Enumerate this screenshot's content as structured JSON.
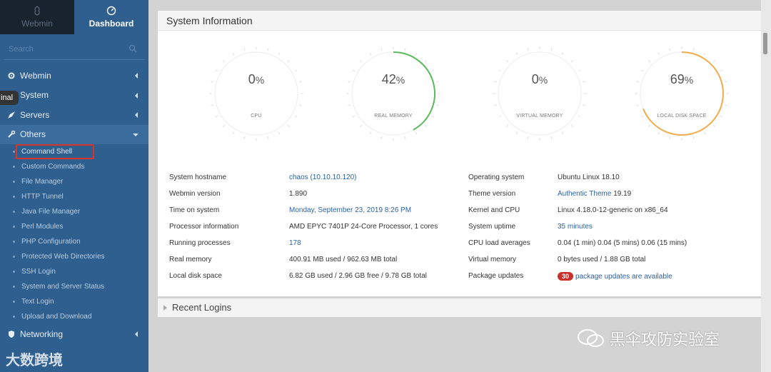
{
  "sidebar": {
    "tabs": [
      {
        "label": "Webmin",
        "icon": "webmin-logo-icon",
        "active": false
      },
      {
        "label": "Dashboard",
        "icon": "dashboard-gauge-icon",
        "active": true
      }
    ],
    "search_placeholder": "Search",
    "items": [
      {
        "label": "Webmin",
        "icon": "gear-icon"
      },
      {
        "label": "System",
        "icon": "wrench-icon"
      },
      {
        "label": "Servers",
        "icon": "rocket-icon"
      },
      {
        "label": "Others",
        "icon": "wrench-icon",
        "open": true
      },
      {
        "label": "Networking",
        "icon": "shield-icon"
      }
    ],
    "others_sub": [
      "Command Shell",
      "Custom Commands",
      "File Manager",
      "HTTP Tunnel",
      "Java File Manager",
      "Perl Modules",
      "PHP Configuration",
      "Protected Web Directories",
      "SSH Login",
      "System and Server Status",
      "Text Login",
      "Upload and Download"
    ],
    "tooltip": "inal",
    "watermark": "大数跨境"
  },
  "main": {
    "panel_title": "System Information",
    "gauges": [
      {
        "value": "0",
        "unit": "%",
        "label": "CPU",
        "percent": 0,
        "color": "#e0e0e0"
      },
      {
        "value": "42",
        "unit": "%",
        "label": "REAL MEMORY",
        "percent": 0.42,
        "color": "#5cb85c"
      },
      {
        "value": "0",
        "unit": "%",
        "label": "VIRTUAL MEMORY",
        "percent": 0,
        "color": "#e0e0e0"
      },
      {
        "value": "69",
        "unit": "%",
        "label": "LOCAL DISK SPACE",
        "percent": 0.69,
        "color": "#f0ad4e"
      }
    ],
    "info_left": [
      {
        "label": "System hostname",
        "value": "chaos (10.10.10.120)",
        "link": true
      },
      {
        "label": "Webmin version",
        "value": "1.890",
        "link": false
      },
      {
        "label": "Time on system",
        "value": "Monday, September 23, 2019 8:26 PM",
        "link": true
      },
      {
        "label": "Processor information",
        "value": "AMD EPYC 7401P 24-Core Processor, 1 cores",
        "link": false
      },
      {
        "label": "Running processes",
        "value": "178",
        "link": true
      },
      {
        "label": "Real memory",
        "value": "400.91 MB used / 962.63 MB total",
        "link": false
      },
      {
        "label": "Local disk space",
        "value": "6.82 GB used / 2.96 GB free / 9.78 GB total",
        "link": false
      }
    ],
    "info_right": [
      {
        "label": "Operating system",
        "value": "Ubuntu Linux 18.10",
        "link": false
      },
      {
        "label": "Theme version",
        "value": "Authentic Theme",
        "value2": " 19.19",
        "link": true
      },
      {
        "label": "Kernel and CPU",
        "value": "Linux 4.18.0-12-generic on x86_64",
        "link": false
      },
      {
        "label": "System uptime",
        "value": "35 minutes",
        "link": true
      },
      {
        "label": "CPU load averages",
        "value": "0.04 (1 min) 0.04 (5 mins) 0.06 (15 mins)",
        "link": false
      },
      {
        "label": "Virtual memory",
        "value": "0 bytes used / 1.88 GB total",
        "link": false
      },
      {
        "label": "Package updates",
        "badge": "30",
        "value": "package updates are available",
        "link": true
      }
    ],
    "recent_logins_title": "Recent Logins",
    "watermark": "黑伞攻防实验室"
  }
}
